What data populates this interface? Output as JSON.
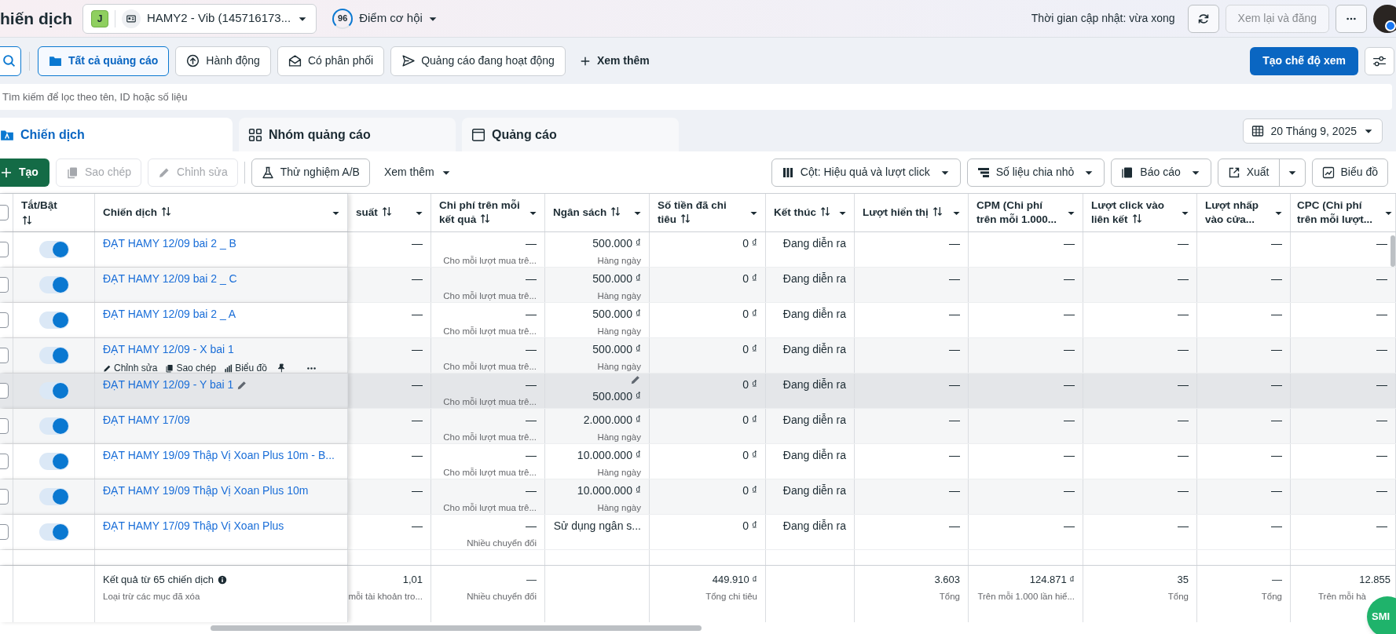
{
  "header": {
    "title": "hiến dịch",
    "account": {
      "badge": "J",
      "name": "HAMY2 - Vib (145716173..."
    },
    "score": {
      "value": "96",
      "label": "Điểm cơ hội"
    },
    "updated": "Thời gian cập nhật: vừa xong",
    "review_button": {
      "label": "Xem lại và đăng",
      "disabled": true
    }
  },
  "filters": [
    {
      "label": "Tất cả quảng cáo",
      "selected": true
    },
    {
      "label": "Hành động",
      "selected": false
    },
    {
      "label": "Có phân phối",
      "selected": false
    },
    {
      "label": "Quảng cáo đang hoạt động",
      "selected": false
    }
  ],
  "more_filters": "Xem thêm",
  "create_view": "Tạo chế độ xem",
  "search": {
    "placeholder": "Tìm kiếm để lọc theo tên, ID hoặc số liệu"
  },
  "tabs": [
    {
      "label": "Chiến dịch",
      "selected": true
    },
    {
      "label": "Nhóm quảng cáo",
      "selected": false
    },
    {
      "label": "Quảng cáo",
      "selected": false
    }
  ],
  "date": "20 Tháng 9, 2025",
  "toolbar": {
    "left": [
      {
        "label": "Tạo",
        "kind": "primary",
        "disabled": false
      },
      {
        "label": "Sao chép",
        "kind": "outline",
        "disabled": true
      },
      {
        "label": "Chỉnh sửa",
        "kind": "outline",
        "disabled": true
      },
      {
        "label": "Thử nghiệm A/B",
        "kind": "outline",
        "disabled": false
      },
      {
        "label": "Xem thêm",
        "kind": "menu",
        "disabled": false
      }
    ],
    "right": [
      {
        "label": "Cột: Hiệu quả và lượt click",
        "kind": "menu"
      },
      {
        "label": "Số liệu chia nhỏ",
        "kind": "menu"
      },
      {
        "label": "Báo cáo",
        "kind": "menu"
      },
      {
        "label": "Xuất",
        "kind": "split"
      },
      {
        "label": "Biểu đồ",
        "kind": "plain"
      }
    ]
  },
  "table": {
    "select_all": {
      "checked": false
    },
    "fixed_columns": [
      {
        "label": "Tắt/Bật",
        "sortable": true
      },
      {
        "label": "Chiến dịch",
        "sortable": true
      }
    ],
    "columns": [
      {
        "label": "suất",
        "sortable": true
      },
      {
        "label": "Chi phí trên mỗi kết quả",
        "sortable": true
      },
      {
        "label": "Ngân sách",
        "sortable": true
      },
      {
        "label": "Số tiền đã chi tiêu",
        "sortable": true
      },
      {
        "label": "Kết thúc",
        "sortable": true
      },
      {
        "label": "Lượt hiển thị",
        "sortable": true
      },
      {
        "label": "CPM (Chi phí trên mỗi 1.000...",
        "sortable": false
      },
      {
        "label": "Lượt click vào liên kết",
        "sortable": true
      },
      {
        "label": "Lượt nhấp vào cửa...",
        "sortable": false
      },
      {
        "label": "CPC (Chi phí trên mỗi lượt...",
        "sortable": false
      }
    ],
    "rows": [
      {
        "name": "ĐẠT HAMY 12/09 bai 2 _ B",
        "selected": false,
        "on": true,
        "hovered": false,
        "cells": [
          {
            "value": "—"
          },
          {
            "value": "—",
            "note": "Cho mỗi lượt mua trê..."
          },
          {
            "value": "500.000 ₫",
            "note": "Hàng ngày"
          },
          {
            "value": "0 ₫"
          },
          {
            "value": "Đang diễn ra"
          },
          {
            "value": "—"
          },
          {
            "value": "—"
          },
          {
            "value": "—"
          },
          {
            "value": "—"
          },
          {
            "value": "—"
          }
        ]
      },
      {
        "name": "ĐẠT HAMY 12/09 bai 2 _ C",
        "selected": false,
        "on": true,
        "hovered": false,
        "cells": [
          {
            "value": "—"
          },
          {
            "value": "—",
            "note": "Cho mỗi lượt mua trê..."
          },
          {
            "value": "500.000 ₫",
            "note": "Hàng ngày"
          },
          {
            "value": "0 ₫"
          },
          {
            "value": "Đang diễn ra"
          },
          {
            "value": "—"
          },
          {
            "value": "—"
          },
          {
            "value": "—"
          },
          {
            "value": "—"
          },
          {
            "value": "—"
          }
        ]
      },
      {
        "name": "ĐẠT HAMY 12/09 bai 2 _ A",
        "selected": false,
        "on": true,
        "hovered": false,
        "cells": [
          {
            "value": "—"
          },
          {
            "value": "—",
            "note": "Cho mỗi lượt mua trê..."
          },
          {
            "value": "500.000 ₫",
            "note": "Hàng ngày"
          },
          {
            "value": "0 ₫"
          },
          {
            "value": "Đang diễn ra"
          },
          {
            "value": "—"
          },
          {
            "value": "—"
          },
          {
            "value": "—"
          },
          {
            "value": "—"
          },
          {
            "value": "—"
          }
        ]
      },
      {
        "name": "ĐẠT HAMY 12/09 - X bai 1",
        "selected": false,
        "on": true,
        "hovered": false,
        "actions": [
          {
            "label": "Chỉnh sửa"
          },
          {
            "label": "Sao chép"
          },
          {
            "label": "Biểu đồ"
          }
        ],
        "cells": [
          {
            "value": "—"
          },
          {
            "value": "—",
            "note": "Cho mỗi lượt mua trê..."
          },
          {
            "value": "500.000 ₫",
            "note": "Hàng ngày"
          },
          {
            "value": "0 ₫"
          },
          {
            "value": "Đang diễn ra"
          },
          {
            "value": "—"
          },
          {
            "value": "—"
          },
          {
            "value": "—"
          },
          {
            "value": "—"
          },
          {
            "value": "—"
          }
        ]
      },
      {
        "name": "ĐẠT HAMY 12/09 - Y bai 1",
        "selected": false,
        "on": true,
        "hovered": true,
        "cells": [
          {
            "value": "—"
          },
          {
            "value": "—",
            "note": "Cho mỗi lượt mua trê..."
          },
          {
            "value": "500.000 ₫"
          },
          {
            "value": "0 ₫"
          },
          {
            "value": "Đang diễn ra"
          },
          {
            "value": "—"
          },
          {
            "value": "—"
          },
          {
            "value": "—"
          },
          {
            "value": "—"
          },
          {
            "value": "—"
          }
        ]
      },
      {
        "name": "ĐẠT HAMY 17/09",
        "selected": false,
        "on": true,
        "hovered": false,
        "cells": [
          {
            "value": "—"
          },
          {
            "value": "—",
            "note": "Cho mỗi lượt mua trê..."
          },
          {
            "value": "2.000.000 ₫",
            "note": "Hàng ngày"
          },
          {
            "value": "0 ₫"
          },
          {
            "value": "Đang diễn ra"
          },
          {
            "value": "—"
          },
          {
            "value": "—"
          },
          {
            "value": "—"
          },
          {
            "value": "—"
          },
          {
            "value": "—"
          }
        ]
      },
      {
        "name": "ĐẠT HAMY 19/09 Thập Vị Xoan Plus 10m - B...",
        "selected": false,
        "on": true,
        "hovered": false,
        "cells": [
          {
            "value": "—"
          },
          {
            "value": "—",
            "note": "Cho mỗi lượt mua trê..."
          },
          {
            "value": "10.000.000 ₫",
            "note": "Hàng ngày"
          },
          {
            "value": "0 ₫"
          },
          {
            "value": "Đang diễn ra"
          },
          {
            "value": "—"
          },
          {
            "value": "—"
          },
          {
            "value": "—"
          },
          {
            "value": "—"
          },
          {
            "value": "—"
          }
        ]
      },
      {
        "name": "ĐẠT HAMY 19/09 Thập Vị Xoan Plus 10m",
        "selected": false,
        "on": true,
        "hovered": false,
        "cells": [
          {
            "value": "—"
          },
          {
            "value": "—",
            "note": "Cho mỗi lượt mua trê..."
          },
          {
            "value": "10.000.000 ₫",
            "note": "Hàng ngày"
          },
          {
            "value": "0 ₫"
          },
          {
            "value": "Đang diễn ra"
          },
          {
            "value": "—"
          },
          {
            "value": "—"
          },
          {
            "value": "—"
          },
          {
            "value": "—"
          },
          {
            "value": "—"
          }
        ]
      },
      {
        "name": "ĐẠT HAMY 17/09 Thập Vị Xoan Plus",
        "selected": false,
        "on": true,
        "hovered": false,
        "cells": [
          {
            "value": "—"
          },
          {
            "value": "—",
            "note": "Nhiều chuyển đổi"
          },
          {
            "value": "Sử dụng ngân s..."
          },
          {
            "value": "0 ₫"
          },
          {
            "value": "Đang diễn ra"
          },
          {
            "value": "—"
          },
          {
            "value": "—"
          },
          {
            "value": "—"
          },
          {
            "value": "—"
          },
          {
            "value": "—"
          }
        ]
      }
    ],
    "footer": {
      "title": "Kết quả từ 65 chiến dịch",
      "note": "Loại trừ các mục đã xóa",
      "cells": [
        {
          "value": "1,01",
          "note": "mỗi tài khoản tro..."
        },
        {
          "value": "—",
          "note": "Nhiều chuyển đổi"
        },
        null,
        {
          "value": "449.910 ₫",
          "note": "Tổng chi tiêu"
        },
        null,
        {
          "value": "3.603",
          "note": "Tổng"
        },
        {
          "value": "124.871 ₫",
          "note": "Trên mỗi 1.000 lần hiể..."
        },
        {
          "value": "35",
          "note": "Tổng"
        },
        {
          "value": "—",
          "note": "Tổng"
        },
        {
          "value": "12.855",
          "note": "Trên mỗi hà"
        }
      ]
    }
  },
  "widget": {
    "label": "SMI"
  }
}
